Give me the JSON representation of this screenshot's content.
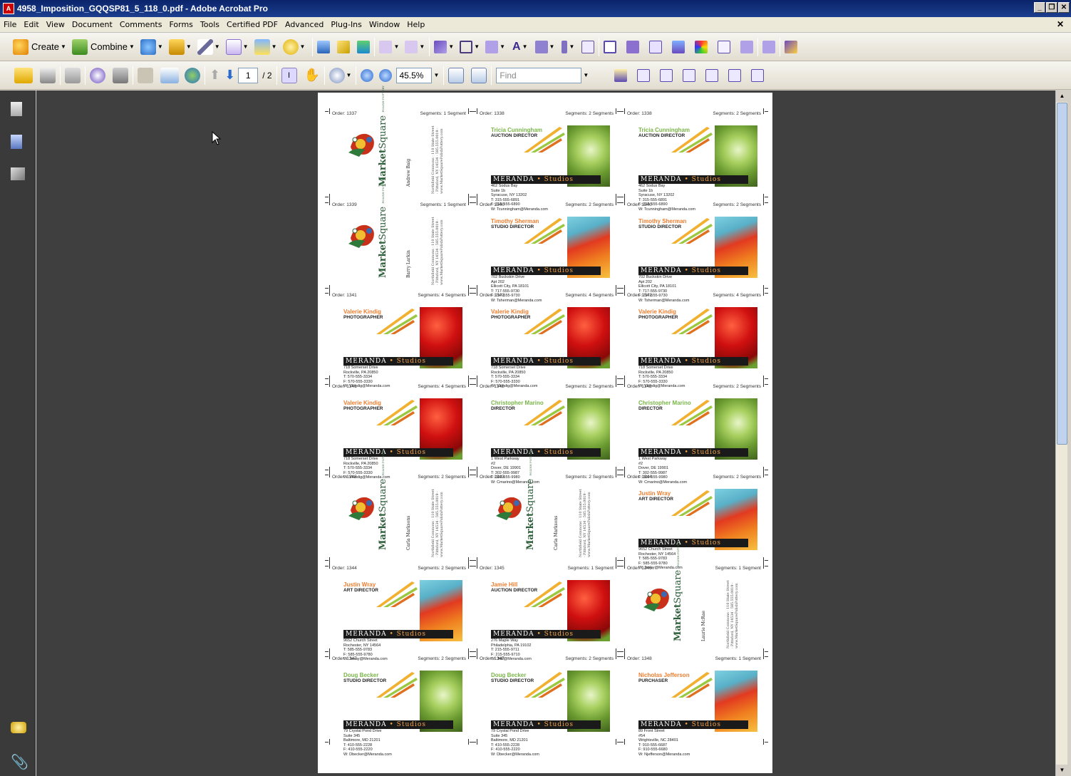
{
  "window": {
    "title": "4958_Imposition_GQQSP81_5_118_0.pdf - Adobe Acrobat Pro"
  },
  "menu": [
    "File",
    "Edit",
    "View",
    "Document",
    "Comments",
    "Forms",
    "Tools",
    "Certified PDF",
    "Advanced",
    "Plug-Ins",
    "Window",
    "Help"
  ],
  "toolbar1": {
    "create_label": "Create",
    "combine_label": "Combine"
  },
  "toolbar2": {
    "page_current": "1",
    "page_total": "/ 2",
    "zoom": "45.5%",
    "find_placeholder": "Find"
  },
  "brand": {
    "name": "MERANDA",
    "studios": "• Studios",
    "market_a": "Market",
    "market_b": "Square",
    "market_sub": "POLISH POTTERY"
  },
  "cards": [
    {
      "order": "Order: 1337",
      "segments": "Segments: 1 Segment",
      "type": "ms",
      "person": "Andrew Baig",
      "contact": "Northfield Commons · 110 State Street · Pittsford, NY 14534 · 585.555.0019 · www.MarketSquarePolishPottery.com"
    },
    {
      "order": "Order: 1338",
      "segments": "Segments: 2 Segments",
      "type": "mer",
      "name": "Tricia Cunningham",
      "title": "AUCTION DIRECTOR",
      "name_color": "#7ab648",
      "photo": "green",
      "address": [
        "462 Sodus Bay",
        "Suite 1b",
        "Syracuse, NY 13202",
        "T: 315-555-6891",
        "F: 315-555-6890",
        "W: Tcunningham@Meranda.com"
      ]
    },
    {
      "order": "Order: 1338",
      "segments": "Segments: 2 Segments",
      "type": "mer",
      "name": "Tricia Cunningham",
      "title": "AUCTION DIRECTOR",
      "name_color": "#7ab648",
      "photo": "green",
      "address": [
        "462 Sodus Bay",
        "Suite 1b",
        "Syracuse, NY 13202",
        "T: 315-555-6891",
        "F: 315-555-6890",
        "W: Tcunningham@Meranda.com"
      ]
    },
    {
      "order": "Order: 1339",
      "segments": "Segments: 1 Segment",
      "type": "ms",
      "person": "Barry Larkin",
      "contact": "Northfield Commons · 110 State Street · Pittsford, NY 14534 · 585.555.0019 · www.MarketSquarePolishPottery.com"
    },
    {
      "order": "Order: 1340",
      "segments": "Segments: 2 Segments",
      "type": "mer",
      "name": "Timothy Sherman",
      "title": "STUDIO DIRECTOR",
      "name_color": "#ef7d2e",
      "photo": "tulip",
      "address": [
        "702 Buckskin Drive",
        "Apt 202",
        "Ellicott City, PA 18101",
        "T: 717-555-9730",
        "F: 717-555-9730",
        "W: Tsherman@Meranda.com"
      ]
    },
    {
      "order": "Order: 1340",
      "segments": "Segments: 2 Segments",
      "type": "mer",
      "name": "Timothy Sherman",
      "title": "STUDIO DIRECTOR",
      "name_color": "#ef7d2e",
      "photo": "tulip",
      "address": [
        "702 Buckskin Drive",
        "Apt 202",
        "Ellicott City, PA 18101",
        "T: 717-555-9730",
        "F: 717-555-9730",
        "W: Tsherman@Meranda.com"
      ]
    },
    {
      "order": "Order: 1341",
      "segments": "Segments: 4 Segments",
      "type": "mer",
      "name": "Valerie Kindig",
      "title": "PHOTOGRAPHER",
      "name_color": "#ef7d2e",
      "photo": "red",
      "address": [
        "718 Somerset Drive",
        "Rockville, PA 20850",
        "T: 570-555-3334",
        "F: 570-555-3330",
        "W: Vkindig@Meranda.com"
      ]
    },
    {
      "order": "Order: 1341",
      "segments": "Segments: 4 Segments",
      "type": "mer",
      "name": "Valerie Kindig",
      "title": "PHOTOGRAPHER",
      "name_color": "#ef7d2e",
      "photo": "red",
      "address": [
        "718 Somerset Drive",
        "Rockville, PA 20850",
        "T: 570-555-3334",
        "F: 570-555-3330",
        "W: Vkindig@Meranda.com"
      ]
    },
    {
      "order": "Order: 1341",
      "segments": "Segments: 4 Segments",
      "type": "mer",
      "name": "Valerie Kindig",
      "title": "PHOTOGRAPHER",
      "name_color": "#ef7d2e",
      "photo": "red",
      "address": [
        "718 Somerset Drive",
        "Rockville, PA 20850",
        "T: 570-555-3334",
        "F: 570-555-3330",
        "W: Vkindig@Meranda.com"
      ]
    },
    {
      "order": "Order: 1341",
      "segments": "Segments: 4 Segments",
      "type": "mer",
      "name": "Valerie Kindig",
      "title": "PHOTOGRAPHER",
      "name_color": "#ef7d2e",
      "photo": "red",
      "address": [
        "718 Somerset Drive",
        "Rockville, PA 20850",
        "T: 570-555-3334",
        "F: 570-555-3330",
        "W: Vkindig@Meranda.com"
      ]
    },
    {
      "order": "Order: 1342",
      "segments": "Segments: 2 Segments",
      "type": "mer",
      "name": "Christopher Marino",
      "title": "DIRECTOR",
      "name_color": "#7ab648",
      "photo": "green",
      "address": [
        "1 West Parkway",
        "#2",
        "Dover, DE 19901",
        "T: 302-555-9987",
        "F: 302-555-9980",
        "W: Cmarino@Meranda.com"
      ]
    },
    {
      "order": "Order: 1342",
      "segments": "Segments: 2 Segments",
      "type": "mer",
      "name": "Christopher Marino",
      "title": "DIRECTOR",
      "name_color": "#7ab648",
      "photo": "green",
      "address": [
        "1 West Parkway",
        "#2",
        "Dover, DE 19901",
        "T: 302-555-9987",
        "F: 302-555-9980",
        "W: Cmarino@Meranda.com"
      ]
    },
    {
      "order": "Order: 1343",
      "segments": "Segments: 2 Segments",
      "type": "ms",
      "person": "Carla Marksons",
      "contact": "Northfield Commons · 110 State Street · Pittsford, NY 14534 · 585.555.0019 · www.MarketSquarePolishPottery.com"
    },
    {
      "order": "Order: 1343",
      "segments": "Segments: 2 Segments",
      "type": "ms",
      "person": "Carla Marksons",
      "contact": "Northfield Commons · 110 State Street · Pittsford, NY 14534 · 585.555.0019 · www.MarketSquarePolishPottery.com"
    },
    {
      "order": "Order: 1344",
      "segments": "Segments: 2 Segments",
      "type": "mer",
      "name": "Justin Wray",
      "title": "ART DIRECTOR",
      "name_color": "#ef7d2e",
      "photo": "tulip",
      "address": [
        "9652 Church Street",
        "Rochester, NY 14564",
        "T: 585-555-9783",
        "F: 585-555-9780",
        "W: Jwray@Meranda.com"
      ]
    },
    {
      "order": "Order: 1344",
      "segments": "Segments: 2 Segments",
      "type": "mer",
      "name": "Justin Wray",
      "title": "ART DIRECTOR",
      "name_color": "#ef7d2e",
      "photo": "tulip",
      "address": [
        "9652 Church Street",
        "Rochester, NY 14564",
        "T: 585-555-9783",
        "F: 585-555-9780",
        "W: Jwray@Meranda.com"
      ]
    },
    {
      "order": "Order: 1345",
      "segments": "Segments: 1 Segment",
      "type": "mer",
      "name": "Jamie Hill",
      "title": "AUCTION DIRECTOR",
      "name_color": "#ef7d2e",
      "photo": "red",
      "address": [
        "276 Maple Way",
        "Philadelphia, PA 19102",
        "T: 215-555-9711",
        "F: 215-555-9710",
        "W: Jhill@Meranda.com"
      ]
    },
    {
      "order": "Order: 1346",
      "segments": "Segments: 1 Segment",
      "type": "ms",
      "person": "Laurie McRae",
      "contact": "Northfield Commons · 110 State Street · Pittsford, NY 14534 · 585.555.0019 · www.MarketSquarePolishPottery.com"
    },
    {
      "order": "Order: 1347",
      "segments": "Segments: 2 Segments",
      "type": "mer",
      "name": "Doug Becker",
      "title": "STUDIO DIRECTOR",
      "name_color": "#7ab648",
      "photo": "green",
      "address": [
        "79 Crystal Pond Drive",
        "Suite 345",
        "Baltimore, MD 21201",
        "T: 410-555-2228",
        "F: 410-555-2220",
        "W: Dbecker@Meranda.com"
      ]
    },
    {
      "order": "Order: 1347",
      "segments": "Segments: 2 Segments",
      "type": "mer",
      "name": "Doug Becker",
      "title": "STUDIO DIRECTOR",
      "name_color": "#7ab648",
      "photo": "green",
      "address": [
        "79 Crystal Pond Drive",
        "Suite 345",
        "Baltimore, MD 21201",
        "T: 410-555-2228",
        "F: 410-555-2220",
        "W: Dbecker@Meranda.com"
      ]
    },
    {
      "order": "Order: 1348",
      "segments": "Segments: 1 Segment",
      "type": "mer",
      "name": "Nicholas Jefferson",
      "title": "PURCHASER",
      "name_color": "#ef7d2e",
      "photo": "tulip",
      "address": [
        "89 Front Street",
        "#54",
        "Wrightsville, NC 28401",
        "T: 910-555-6687",
        "F: 910-555-6680",
        "W: Njefferson@Meranda.com"
      ]
    }
  ],
  "colors": {
    "titlebar": "#0a246a",
    "doc_background": "#3f3f3f",
    "orange": "#ef7d2e",
    "green": "#7ab648"
  }
}
